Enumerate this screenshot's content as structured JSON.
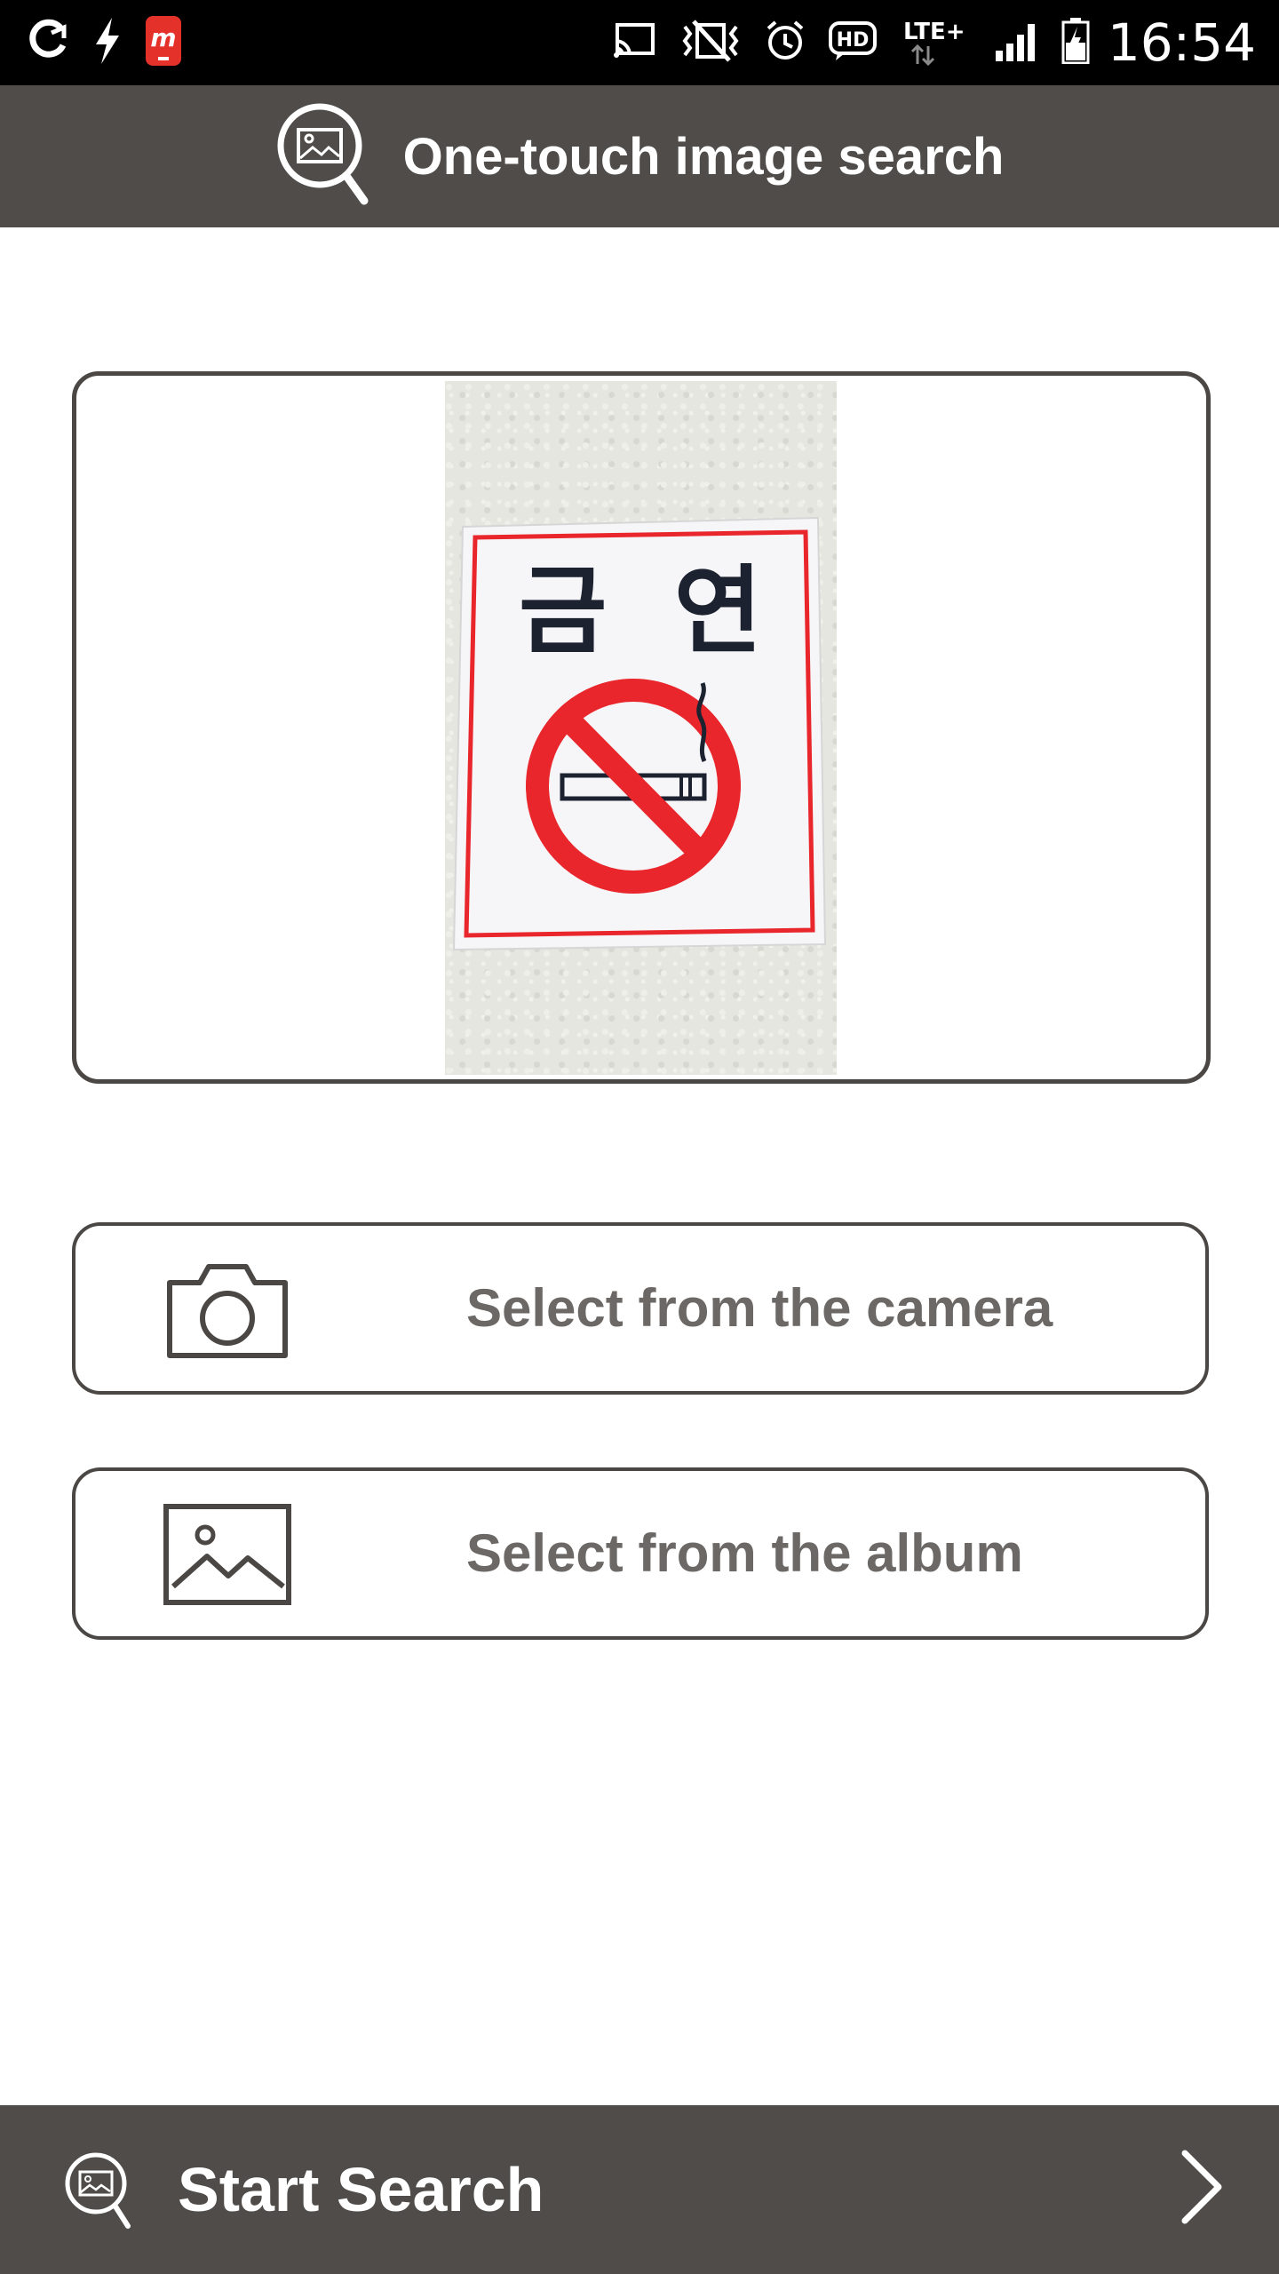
{
  "status_bar": {
    "time": "16:54",
    "left_icons": [
      "olleh-icon",
      "flash-icon",
      "samsung-app-icon"
    ],
    "right_icons": [
      "cast-icon",
      "vibrate-icon",
      "alarm-icon",
      "hd-icon",
      "lte-plus-icon",
      "signal-icon",
      "battery-icon"
    ],
    "hd_text": "HD",
    "lte_text": "LTE+"
  },
  "app_bar": {
    "title": "One-touch image search",
    "icon": "image-search-icon"
  },
  "preview": {
    "sign_text": "금  연"
  },
  "actions": {
    "camera_label": "Select from the camera",
    "album_label": "Select from the album"
  },
  "bottom_bar": {
    "label": "Start Search",
    "icon": "image-search-icon",
    "chevron": "chevron-right-icon"
  },
  "colors": {
    "bar_background": "#4f4c49",
    "status_background": "#000000",
    "button_text": "#6b6866",
    "sign_red": "#e8262b"
  }
}
